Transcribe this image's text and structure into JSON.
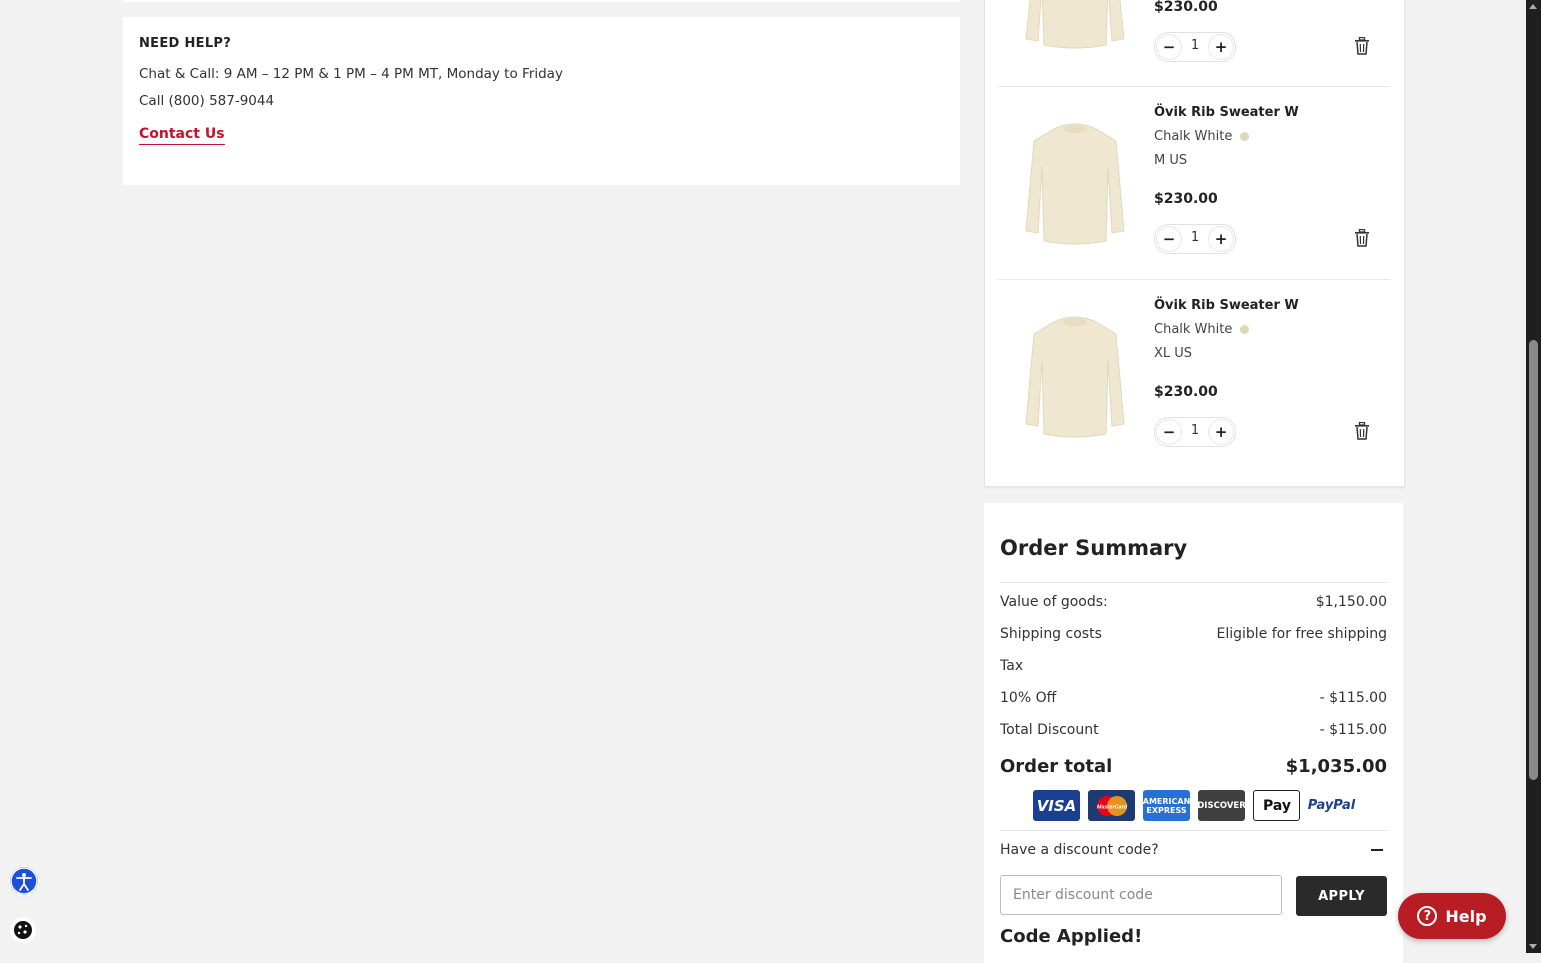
{
  "help": {
    "title": "NEED HELP?",
    "hours": "Chat & Call: 9 AM – 12 PM & 1 PM – 4 PM MT, Monday to Friday",
    "phone": "Call (800) 587-9044",
    "contact_link": "Contact Us"
  },
  "cart": {
    "partial_item": {
      "price": "$230.00",
      "qty": "1"
    },
    "items": [
      {
        "name": "Övik Rib Sweater W",
        "color": "Chalk White",
        "size": "M US",
        "price": "$230.00",
        "qty": "1"
      },
      {
        "name": "Övik Rib Sweater W",
        "color": "Chalk White",
        "size": "XL US",
        "price": "$230.00",
        "qty": "1"
      }
    ]
  },
  "summary": {
    "title": "Order Summary",
    "rows": [
      {
        "label": "Value of goods:",
        "value": "$1,150.00"
      },
      {
        "label": "Shipping costs",
        "value": "Eligible for free shipping"
      },
      {
        "label": "Tax",
        "value": ""
      },
      {
        "label": "10% Off",
        "value": "- $115.00"
      },
      {
        "label": "Total Discount",
        "value": "- $115.00"
      }
    ],
    "total_label": "Order total",
    "total_value": "$1,035.00",
    "payments": [
      "VISA",
      "MasterCard",
      "AMERICAN EXPRESS",
      "DISCOVER",
      "Pay",
      "PayPal"
    ],
    "discount_question": "Have a discount code?",
    "discount_placeholder": "Enter discount code",
    "apply_label": "APPLY",
    "code_applied": "Code Applied!"
  },
  "help_widget": {
    "label": "Help"
  },
  "colors": {
    "brand_red": "#c8102e",
    "help_button": "#b81d24",
    "accessibility": "#1d4fd8"
  },
  "icons": [
    "minus-icon",
    "plus-icon",
    "trash-icon",
    "question-icon",
    "accessibility-icon",
    "cookie-icon"
  ]
}
